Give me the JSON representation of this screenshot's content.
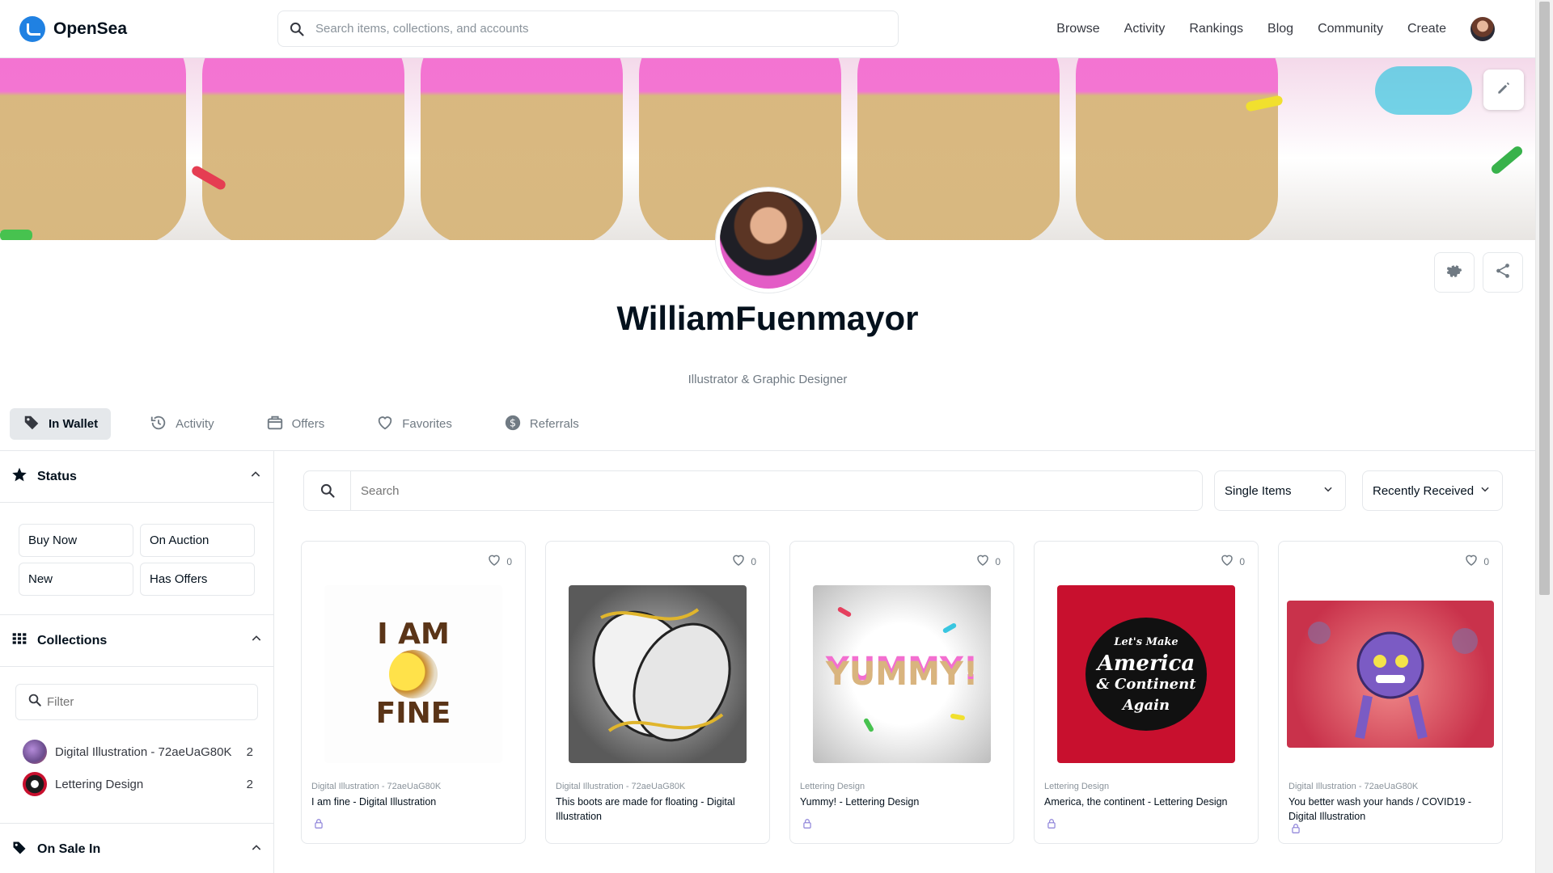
{
  "app": {
    "logo_text": "OpenSea"
  },
  "search": {
    "placeholder": "Search items, collections, and accounts"
  },
  "nav": {
    "items": [
      {
        "label": "Browse"
      },
      {
        "label": "Activity"
      },
      {
        "label": "Rankings"
      },
      {
        "label": "Blog"
      },
      {
        "label": "Community"
      },
      {
        "label": "Create"
      }
    ]
  },
  "profile": {
    "name": "WilliamFuenmayor",
    "bio": "Illustrator & Graphic Designer"
  },
  "tabs": [
    {
      "label": "In Wallet",
      "icon": "tag-icon",
      "active": true
    },
    {
      "label": "Activity",
      "icon": "history-icon"
    },
    {
      "label": "Offers",
      "icon": "offers-icon"
    },
    {
      "label": "Favorites",
      "icon": "heart-icon"
    },
    {
      "label": "Referrals",
      "icon": "dollar-icon"
    }
  ],
  "sidebar": {
    "status": {
      "title": "Status",
      "buttons": [
        "Buy Now",
        "On Auction",
        "New",
        "Has Offers"
      ]
    },
    "collections": {
      "title": "Collections",
      "filter_placeholder": "Filter",
      "items": [
        {
          "name": "Digital Illustration - 72aeUaG80K",
          "count": "2"
        },
        {
          "name": "Lettering Design",
          "count": "2"
        }
      ]
    },
    "on_sale": {
      "title": "On Sale In"
    }
  },
  "main": {
    "search_placeholder": "Search",
    "item_type": "Single Items",
    "sort": "Recently Received"
  },
  "cards": [
    {
      "favorites": "0",
      "collection": "Digital Illustration - 72aeUaG80K",
      "title": "I am fine - Digital Illustration",
      "art_text_1": "I AM",
      "art_text_2": "FINE"
    },
    {
      "favorites": "0",
      "collection": "Digital Illustration - 72aeUaG80K",
      "title": "This boots are made for floating - Digital Illustration"
    },
    {
      "favorites": "0",
      "collection": "Lettering Design",
      "title": "Yummy! - Lettering Design",
      "art_text": "YUMMY!"
    },
    {
      "favorites": "0",
      "collection": "Lettering Design",
      "title": "America, the continent - Lettering Design",
      "art_text_1": "Let's Make",
      "art_text_2": "America",
      "art_text_3": "& Continent",
      "art_text_4": "Again"
    },
    {
      "favorites": "0",
      "collection": "Digital Illustration - 72aeUaG80K",
      "title": "You better wash your hands / COVID19 - Digital Illustration"
    }
  ],
  "colors": {
    "accent": "#2081e2",
    "border": "#e5e8eb",
    "text": "#04111d",
    "muted": "#707a83"
  }
}
